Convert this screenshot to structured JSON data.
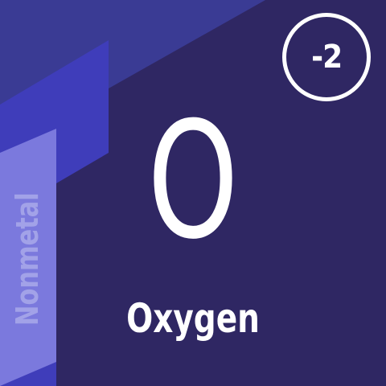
{
  "element": {
    "symbol": "O",
    "name": "Oxygen",
    "category": "Nonmetal",
    "charge": "-2"
  },
  "colors": {
    "background": "#2f2763",
    "band_dark": "#3a3b94",
    "band_mid": "#3f3dba",
    "band_light": "#7b79dd",
    "category_text": "#a2a2e8",
    "text": "#ffffff"
  }
}
